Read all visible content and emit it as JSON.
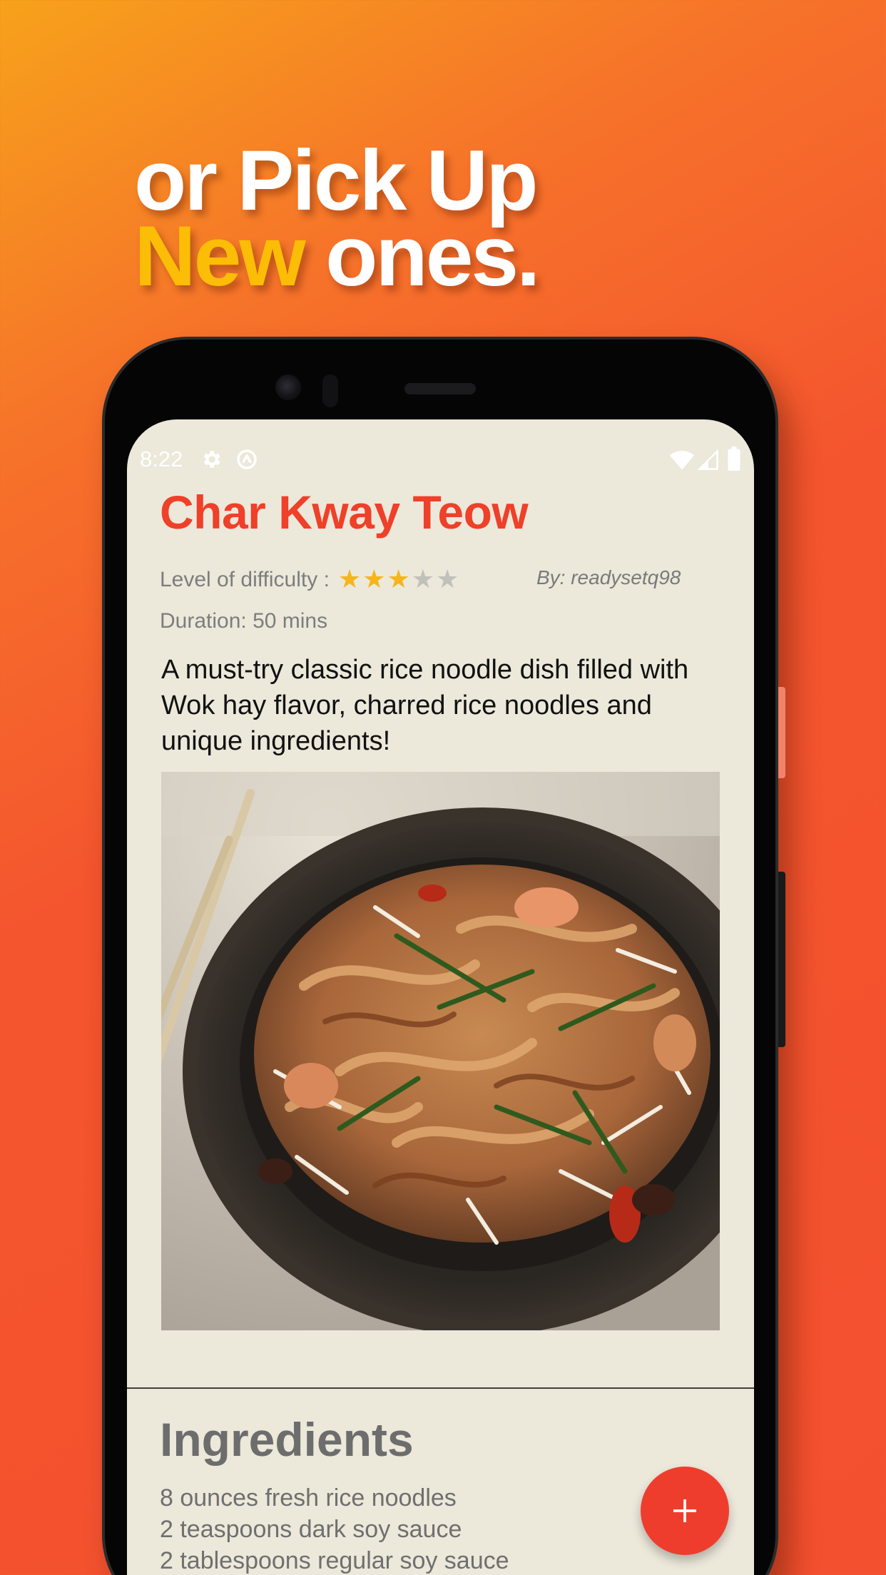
{
  "headline": {
    "line1": "or Pick Up",
    "accent": "New",
    "line2_rest": " ones."
  },
  "status_bar": {
    "time": "8:22",
    "icons": [
      "gear-icon",
      "sync-icon",
      "wifi-icon",
      "signal-icon",
      "battery-icon"
    ]
  },
  "recipe": {
    "title": "Char Kway Teow",
    "difficulty_label": "Level of difficulty :",
    "difficulty_rating": 3,
    "difficulty_max": 5,
    "author": "By: readysetq98",
    "duration": "Duration: 50 mins",
    "description": "A must-try classic rice noodle dish filled with Wok hay flavor, charred rice noodles and unique ingredients!"
  },
  "ingredients": {
    "heading": "Ingredients",
    "items": [
      "8 ounces fresh rice noodles",
      "2 teaspoons dark soy sauce",
      "2 tablespoons regular soy sauce"
    ]
  },
  "fab": {
    "icon": "plus-icon"
  },
  "colors": {
    "background_start": "#f7a21b",
    "background_end": "#f3502f",
    "accent_yellow": "#fbbd06",
    "title_red": "#ef4029",
    "screen_bg": "#ece8da",
    "star_filled": "#f5b51b",
    "star_empty": "#c2c0bb",
    "fab": "#ef3d2d"
  }
}
